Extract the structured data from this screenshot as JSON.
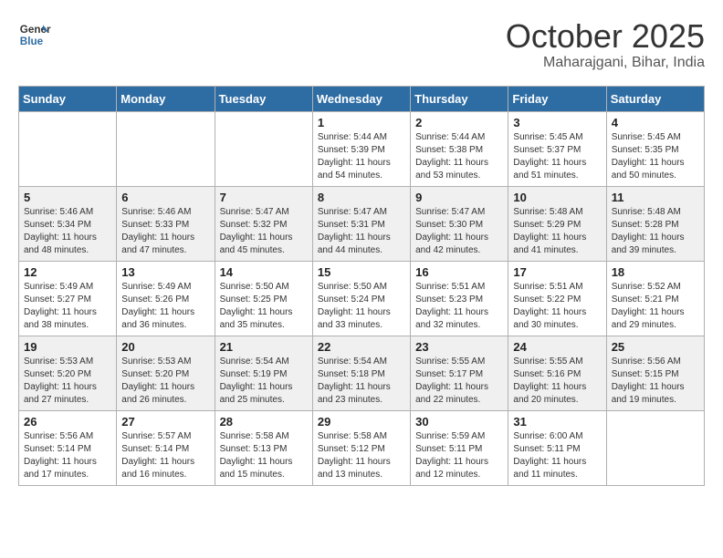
{
  "header": {
    "logo_general": "General",
    "logo_blue": "Blue",
    "month_title": "October 2025",
    "location": "Maharajgani, Bihar, India"
  },
  "weekdays": [
    "Sunday",
    "Monday",
    "Tuesday",
    "Wednesday",
    "Thursday",
    "Friday",
    "Saturday"
  ],
  "weeks": [
    [
      {
        "day": "",
        "info": ""
      },
      {
        "day": "",
        "info": ""
      },
      {
        "day": "",
        "info": ""
      },
      {
        "day": "1",
        "info": "Sunrise: 5:44 AM\nSunset: 5:39 PM\nDaylight: 11 hours and 54 minutes."
      },
      {
        "day": "2",
        "info": "Sunrise: 5:44 AM\nSunset: 5:38 PM\nDaylight: 11 hours and 53 minutes."
      },
      {
        "day": "3",
        "info": "Sunrise: 5:45 AM\nSunset: 5:37 PM\nDaylight: 11 hours and 51 minutes."
      },
      {
        "day": "4",
        "info": "Sunrise: 5:45 AM\nSunset: 5:35 PM\nDaylight: 11 hours and 50 minutes."
      }
    ],
    [
      {
        "day": "5",
        "info": "Sunrise: 5:46 AM\nSunset: 5:34 PM\nDaylight: 11 hours and 48 minutes."
      },
      {
        "day": "6",
        "info": "Sunrise: 5:46 AM\nSunset: 5:33 PM\nDaylight: 11 hours and 47 minutes."
      },
      {
        "day": "7",
        "info": "Sunrise: 5:47 AM\nSunset: 5:32 PM\nDaylight: 11 hours and 45 minutes."
      },
      {
        "day": "8",
        "info": "Sunrise: 5:47 AM\nSunset: 5:31 PM\nDaylight: 11 hours and 44 minutes."
      },
      {
        "day": "9",
        "info": "Sunrise: 5:47 AM\nSunset: 5:30 PM\nDaylight: 11 hours and 42 minutes."
      },
      {
        "day": "10",
        "info": "Sunrise: 5:48 AM\nSunset: 5:29 PM\nDaylight: 11 hours and 41 minutes."
      },
      {
        "day": "11",
        "info": "Sunrise: 5:48 AM\nSunset: 5:28 PM\nDaylight: 11 hours and 39 minutes."
      }
    ],
    [
      {
        "day": "12",
        "info": "Sunrise: 5:49 AM\nSunset: 5:27 PM\nDaylight: 11 hours and 38 minutes."
      },
      {
        "day": "13",
        "info": "Sunrise: 5:49 AM\nSunset: 5:26 PM\nDaylight: 11 hours and 36 minutes."
      },
      {
        "day": "14",
        "info": "Sunrise: 5:50 AM\nSunset: 5:25 PM\nDaylight: 11 hours and 35 minutes."
      },
      {
        "day": "15",
        "info": "Sunrise: 5:50 AM\nSunset: 5:24 PM\nDaylight: 11 hours and 33 minutes."
      },
      {
        "day": "16",
        "info": "Sunrise: 5:51 AM\nSunset: 5:23 PM\nDaylight: 11 hours and 32 minutes."
      },
      {
        "day": "17",
        "info": "Sunrise: 5:51 AM\nSunset: 5:22 PM\nDaylight: 11 hours and 30 minutes."
      },
      {
        "day": "18",
        "info": "Sunrise: 5:52 AM\nSunset: 5:21 PM\nDaylight: 11 hours and 29 minutes."
      }
    ],
    [
      {
        "day": "19",
        "info": "Sunrise: 5:53 AM\nSunset: 5:20 PM\nDaylight: 11 hours and 27 minutes."
      },
      {
        "day": "20",
        "info": "Sunrise: 5:53 AM\nSunset: 5:20 PM\nDaylight: 11 hours and 26 minutes."
      },
      {
        "day": "21",
        "info": "Sunrise: 5:54 AM\nSunset: 5:19 PM\nDaylight: 11 hours and 25 minutes."
      },
      {
        "day": "22",
        "info": "Sunrise: 5:54 AM\nSunset: 5:18 PM\nDaylight: 11 hours and 23 minutes."
      },
      {
        "day": "23",
        "info": "Sunrise: 5:55 AM\nSunset: 5:17 PM\nDaylight: 11 hours and 22 minutes."
      },
      {
        "day": "24",
        "info": "Sunrise: 5:55 AM\nSunset: 5:16 PM\nDaylight: 11 hours and 20 minutes."
      },
      {
        "day": "25",
        "info": "Sunrise: 5:56 AM\nSunset: 5:15 PM\nDaylight: 11 hours and 19 minutes."
      }
    ],
    [
      {
        "day": "26",
        "info": "Sunrise: 5:56 AM\nSunset: 5:14 PM\nDaylight: 11 hours and 17 minutes."
      },
      {
        "day": "27",
        "info": "Sunrise: 5:57 AM\nSunset: 5:14 PM\nDaylight: 11 hours and 16 minutes."
      },
      {
        "day": "28",
        "info": "Sunrise: 5:58 AM\nSunset: 5:13 PM\nDaylight: 11 hours and 15 minutes."
      },
      {
        "day": "29",
        "info": "Sunrise: 5:58 AM\nSunset: 5:12 PM\nDaylight: 11 hours and 13 minutes."
      },
      {
        "day": "30",
        "info": "Sunrise: 5:59 AM\nSunset: 5:11 PM\nDaylight: 11 hours and 12 minutes."
      },
      {
        "day": "31",
        "info": "Sunrise: 6:00 AM\nSunset: 5:11 PM\nDaylight: 11 hours and 11 minutes."
      },
      {
        "day": "",
        "info": ""
      }
    ]
  ]
}
